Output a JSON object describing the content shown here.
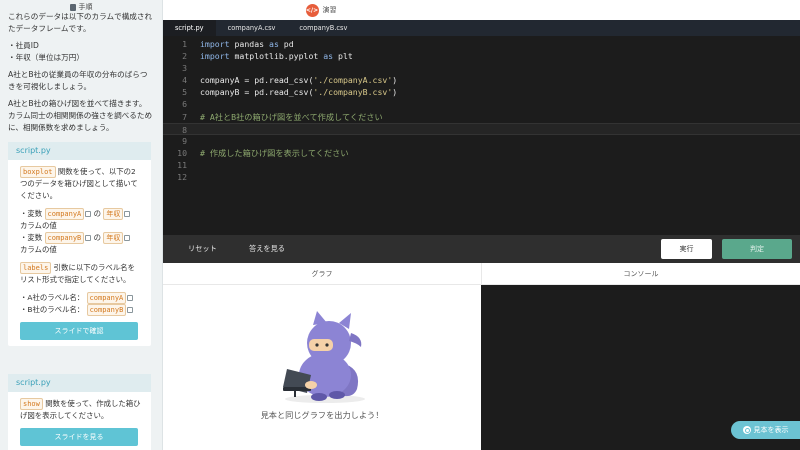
{
  "app": {
    "logo": "</>",
    "title": "演習"
  },
  "sidebar": {
    "header": "手順",
    "intro": [
      "これらのデータは以下のカラムで構成されたデータフレームです。",
      "・社員ID",
      "・年収（単位は万円）",
      "A社とB社の従業員の年収の分布のばらつきを可視化しましょう。",
      "A社とB社の箱ひげ図を並べて描きます。カラム同士の相関関係の強さを調べるために、相関係数を求めましょう。"
    ],
    "task1": {
      "title": "script.py",
      "tag_boxplot": "boxplot",
      "text1": "関数を使って、以下の2つのデータを箱ひげ図として描いてください。",
      "var_prefix": "・変数",
      "var1": "companyA",
      "no": "の",
      "col": "年収",
      "col_suffix": "カラムの値",
      "var2": "companyB",
      "tag_labels": "labels",
      "text2": "引数に以下のラベル名をリスト形式で指定してください。",
      "labelA_prefix": "・A社のラベル名：",
      "labelA": "companyA",
      "labelB_prefix": "・B社のラベル名：",
      "labelB": "companyB",
      "button": "スライドで確認"
    },
    "task2": {
      "title": "script.py",
      "tag_show": "show",
      "text": "関数を使って、作成した箱ひげ図を表示してください。",
      "button": "スライドを見る"
    }
  },
  "tabs": [
    "script.py",
    "companyA.csv",
    "companyB.csv"
  ],
  "editor": {
    "lines": [
      {
        "n": "1",
        "parts": [
          {
            "t": "import",
            "c": "kw"
          },
          {
            "t": " pandas ",
            "c": ""
          },
          {
            "t": "as",
            "c": "kw"
          },
          {
            "t": " pd",
            "c": ""
          }
        ]
      },
      {
        "n": "2",
        "parts": [
          {
            "t": "import",
            "c": "kw"
          },
          {
            "t": " matplotlib.pyplot ",
            "c": ""
          },
          {
            "t": "as",
            "c": "kw"
          },
          {
            "t": " plt",
            "c": ""
          }
        ]
      },
      {
        "n": "3",
        "parts": []
      },
      {
        "n": "4",
        "parts": [
          {
            "t": "companyA = pd.read_csv(",
            "c": ""
          },
          {
            "t": "'./companyA.csv'",
            "c": "str"
          },
          {
            "t": ")",
            "c": ""
          }
        ]
      },
      {
        "n": "5",
        "parts": [
          {
            "t": "companyB = pd.read_csv(",
            "c": ""
          },
          {
            "t": "'./companyB.csv'",
            "c": "str"
          },
          {
            "t": ")",
            "c": ""
          }
        ]
      },
      {
        "n": "6",
        "parts": []
      },
      {
        "n": "7",
        "parts": [
          {
            "t": "# A社とB社の箱ひげ図を並べて作成してください",
            "c": "cm"
          }
        ]
      },
      {
        "n": "8",
        "parts": [],
        "current": true
      },
      {
        "n": "9",
        "parts": []
      },
      {
        "n": "10",
        "parts": [
          {
            "t": "# 作成した箱ひげ図を表示してください",
            "c": "cm"
          }
        ]
      },
      {
        "n": "11",
        "parts": []
      },
      {
        "n": "12",
        "parts": []
      }
    ]
  },
  "actions": {
    "reset": "リセット",
    "answer": "答えを見る",
    "run": "実行",
    "judge": "判定"
  },
  "graph": {
    "header": "グラフ",
    "caption": "見本と同じグラフを出力しよう！"
  },
  "console": {
    "header": "コンソール"
  },
  "sample_button": "見本を表示",
  "colors": {
    "accent": "#5fc4d5",
    "judge": "#5aa88c",
    "editor_bg": "#1c1c1c",
    "tag": "#d3791f"
  }
}
